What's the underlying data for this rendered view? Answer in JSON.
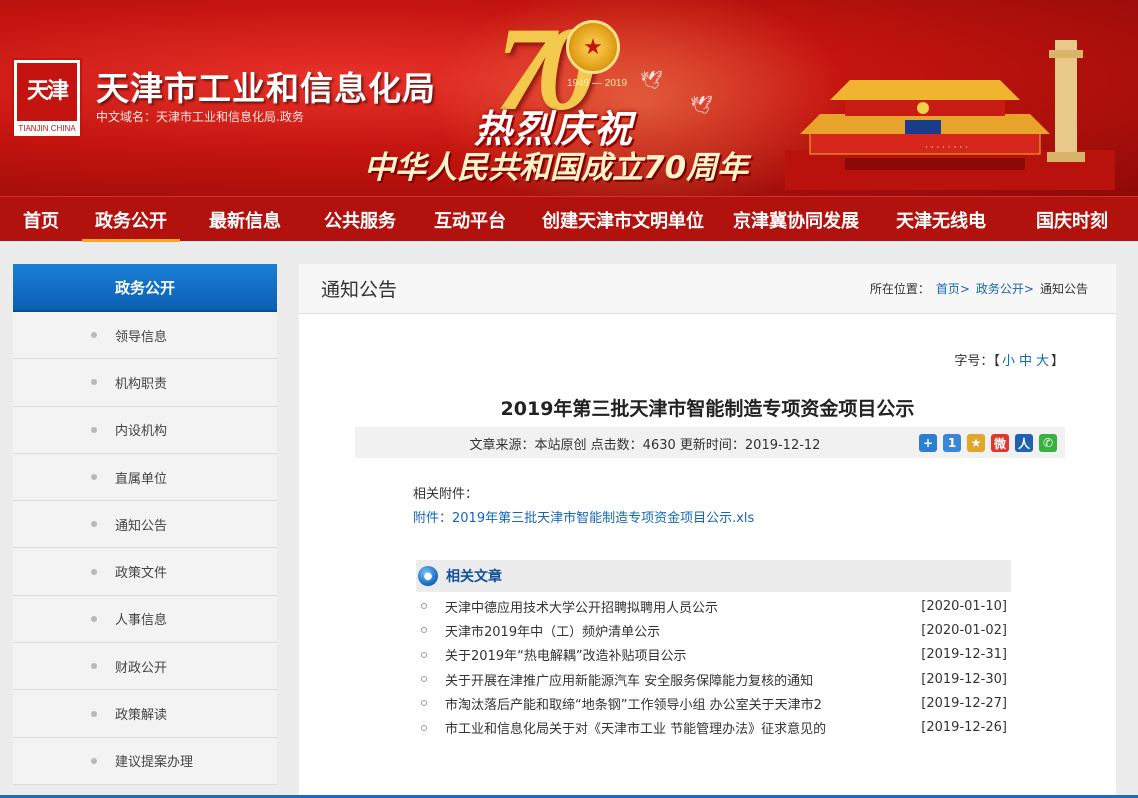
{
  "header": {
    "logo_text": "天津",
    "logo_en": "TIANJIN CHINA",
    "site_title": "天津市工业和信息化局",
    "domain_text": "中文域名：天津市工业和信息化局.政务",
    "banner_number": "70",
    "banner_years": "1949 — 2019",
    "slogan_line1": "热烈庆祝",
    "slogan_line2": "中华人民共和国成立70周年"
  },
  "nav": {
    "items": [
      "首页",
      "政务公开",
      "最新信息",
      "公共服务",
      "互动平台",
      "创建天津市文明单位",
      "京津冀协同发展",
      "天津无线电",
      "国庆时刻"
    ],
    "active_index": 1,
    "active_color": "#f5a623"
  },
  "sidebar": {
    "title": "政务公开",
    "items": [
      "领导信息",
      "机构职责",
      "内设机构",
      "直属单位",
      "通知公告",
      "政策文件",
      "人事信息",
      "财政公开",
      "政策解读",
      "建议提案办理"
    ]
  },
  "main": {
    "section_title": "通知公告",
    "breadcrumb": {
      "label": "所在位置：",
      "home": "首页",
      "level1": "政务公开",
      "current": "通知公告"
    },
    "font_size": {
      "label": "字号：",
      "open": "【",
      "small": "小",
      "medium": "中",
      "large": "大",
      "close": "】"
    },
    "article": {
      "title": "2019年第三批天津市智能制造专项资金项目公示",
      "meta": "文章来源：本站原创 点击数：4630 更新时间：2019-12-12",
      "attachment_label": "相关附件：",
      "attachment_link": "附件：2019年第三批天津市智能制造专项资金项目公示.xls"
    },
    "share_icons": [
      {
        "name": "plus-share-icon",
        "glyph": "+",
        "color": "#2b7fd1"
      },
      {
        "name": "qzone-share-icon",
        "glyph": "1",
        "color": "#3b86d6"
      },
      {
        "name": "star-share-icon",
        "glyph": "★",
        "color": "#e0a62a"
      },
      {
        "name": "weibo-share-icon",
        "glyph": "微",
        "color": "#e2362c"
      },
      {
        "name": "renren-share-icon",
        "glyph": "人",
        "color": "#1f62b5"
      },
      {
        "name": "wechat-share-icon",
        "glyph": "✆",
        "color": "#3ab03e"
      }
    ],
    "related": {
      "title": "相关文章",
      "items": [
        {
          "title": "天津中德应用技术大学公开招聘拟聘用人员公示",
          "date": "[2020-01-10]"
        },
        {
          "title": "天津市2019年中（工）频炉清单公示",
          "date": "[2020-01-02]"
        },
        {
          "title": "关于2019年“热电解耦”改造补贴项目公示",
          "date": "[2019-12-31]"
        },
        {
          "title": "关于开展在津推广应用新能源汽车 安全服务保障能力复核的通知",
          "date": "[2019-12-30]"
        },
        {
          "title": "市淘汰落后产能和取缔“地条钢”工作领导小组 办公室关于天津市2",
          "date": "[2019-12-27]"
        },
        {
          "title": "市工业和信息化局关于对《天津市工业 节能管理办法》征求意见的",
          "date": "[2019-12-26]"
        }
      ]
    }
  }
}
